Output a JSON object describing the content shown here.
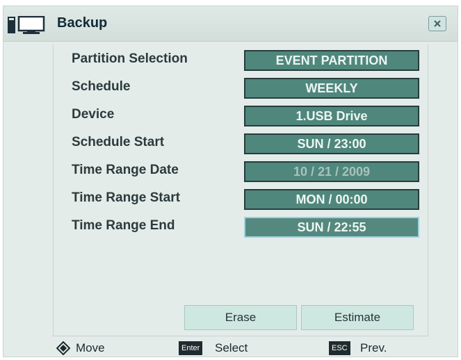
{
  "window": {
    "title": "Backup"
  },
  "settings": [
    {
      "label": "Partition Selection",
      "value": "EVENT PARTITION"
    },
    {
      "label": "Schedule",
      "value": "WEEKLY"
    },
    {
      "label": "Device",
      "value": "1.USB Drive"
    },
    {
      "label": "Schedule Start",
      "value": "SUN / 23:00"
    },
    {
      "label": "Time Range Date",
      "value": "10 / 21 / 2009"
    },
    {
      "label": "Time Range Start",
      "value": "MON / 00:00"
    },
    {
      "label": "Time Range End",
      "value": "SUN / 22:55"
    }
  ],
  "buttons": {
    "erase": "Erase",
    "estimate": "Estimate"
  },
  "footer": {
    "move_label": "Move",
    "enter_key": "Enter",
    "select_label": "Select",
    "esc_key": "ESC",
    "prev_label": "Prev."
  },
  "colors": {
    "value_box": "#4f877d",
    "window_bg": "#e3ece9",
    "button_bg": "#cfe7e1"
  }
}
